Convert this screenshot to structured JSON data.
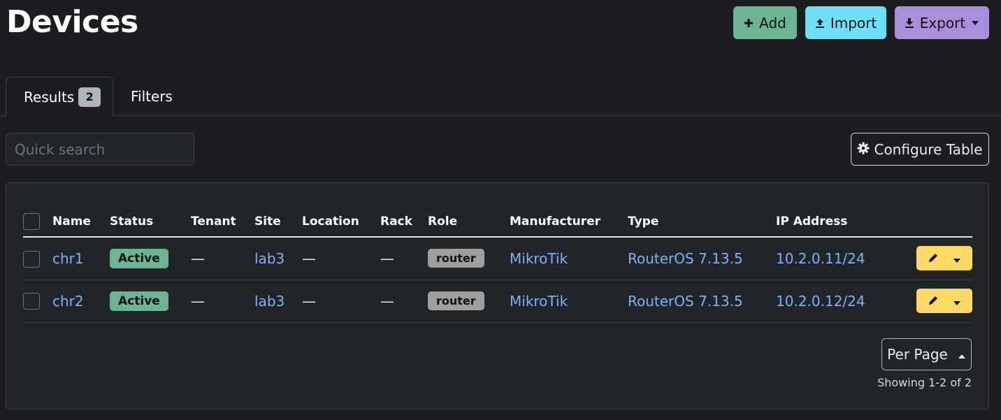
{
  "page": {
    "title": "Devices"
  },
  "header_actions": {
    "add_label": "Add",
    "import_label": "Import",
    "export_label": "Export"
  },
  "tabs": [
    {
      "label": "Results",
      "count": "2"
    },
    {
      "label": "Filters"
    }
  ],
  "search": {
    "placeholder": "Quick search"
  },
  "configure_label": "Configure Table",
  "table": {
    "columns": [
      "Name",
      "Status",
      "Tenant",
      "Site",
      "Location",
      "Rack",
      "Role",
      "Manufacturer",
      "Type",
      "IP Address"
    ],
    "rows": [
      {
        "name": "chr1",
        "status": "Active",
        "tenant": "—",
        "site": "lab3",
        "location": "—",
        "rack": "—",
        "role": "router",
        "manufacturer": "MikroTik",
        "type": "RouterOS 7.13.5",
        "ip": "10.2.0.11/24"
      },
      {
        "name": "chr2",
        "status": "Active",
        "tenant": "—",
        "site": "lab3",
        "location": "—",
        "rack": "—",
        "role": "router",
        "manufacturer": "MikroTik",
        "type": "RouterOS 7.13.5",
        "ip": "10.2.0.12/24"
      }
    ]
  },
  "pagination": {
    "per_page_label": "Per Page",
    "showing": "Showing 1-2 of 2"
  },
  "colors": {
    "add": "#6cb592",
    "import": "#6edff6",
    "export": "#a98eda",
    "edit": "#ffd966",
    "link": "#7fb2f5"
  }
}
